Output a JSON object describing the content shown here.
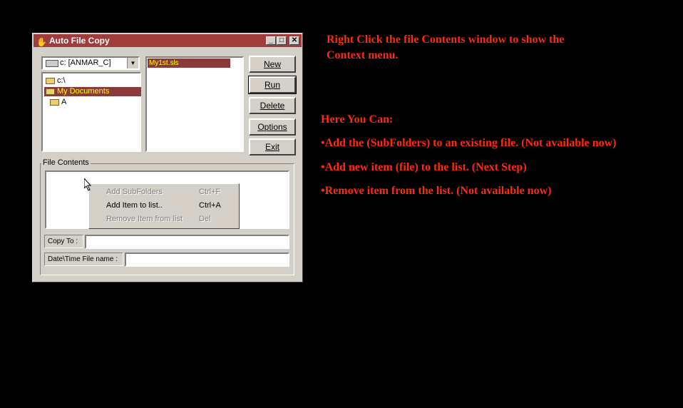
{
  "window": {
    "title": "Auto File Copy",
    "minimize": "_",
    "maximize": "□",
    "close": "✕"
  },
  "drive_select": {
    "value": "c: [ANMAR_C]"
  },
  "folder_tree": [
    {
      "label": "c:\\"
    },
    {
      "label": "My Documents"
    },
    {
      "label": "A"
    }
  ],
  "file_list": [
    {
      "label": "My1st.sls"
    }
  ],
  "buttons": {
    "new": "New",
    "run": "Run",
    "delete": "Delete",
    "options": "Options",
    "exit": "Exit"
  },
  "file_contents": {
    "label": "File Contents"
  },
  "context_menu": {
    "items": [
      {
        "label": "Add SubFolders",
        "shortcut": "Ctrl+F",
        "enabled": false
      },
      {
        "label": "Add Item to list..",
        "shortcut": "Ctrl+A",
        "enabled": true
      },
      {
        "label": "Remove Item from list",
        "shortcut": "Del",
        "enabled": false
      }
    ]
  },
  "copy_to": {
    "label": "Copy To :",
    "value": ""
  },
  "datetime": {
    "label": "Date\\Time File name :",
    "value": ""
  },
  "instructions": {
    "line1": "Right Click the file Contents window to show the",
    "line2": "Context menu.",
    "heading": "Here You Can:",
    "bullets": [
      "•Add the (SubFolders) to an existing file. (Not available now)",
      "•Add new item (file) to the list. (Next Step)",
      "•Remove item from the list. (Not available now)"
    ]
  },
  "colors": {
    "titlebar": "#a03c3c",
    "selection": "#8a3a3a",
    "instruction_text": "#ff2a10"
  }
}
